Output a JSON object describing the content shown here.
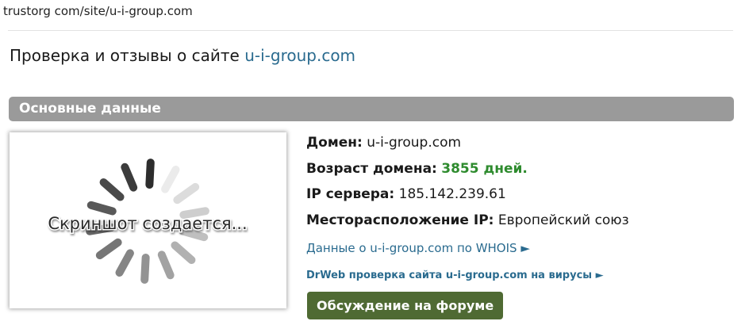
{
  "address_bar": {
    "url": "trustorg com/site/u-i-group.com"
  },
  "page": {
    "title_prefix": "Проверка и отзывы о сайте",
    "title_domain": "u-i-group.com"
  },
  "section": {
    "title": "Основные данные"
  },
  "screenshot": {
    "placeholder_text": "Скриншот создается..."
  },
  "info": {
    "domain_label": "Домен:",
    "domain_value": "u-i-group.com",
    "age_label": "Возраст домена:",
    "age_value": "3855 дней.",
    "ip_label": "IP сервера:",
    "ip_value": "185.142.239.61",
    "location_label": "Месторасположение IP:",
    "location_value": "Европейский союз",
    "whois_link": "Данные о u-i-group.com по WHOIS ►",
    "drweb_link": "DrWeb проверка сайта u-i-group.com на вирусы ►"
  },
  "forum_button": {
    "label": "Обсуждение на форуме"
  },
  "colors": {
    "link": "#2a6b8f",
    "age_green": "#2e8b2e",
    "section_bar": "#9a9a9a",
    "forum_button": "#4f6a33"
  }
}
